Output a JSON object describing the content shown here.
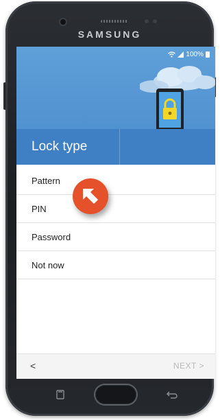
{
  "device": {
    "brand": "SAMSUNG"
  },
  "status_bar": {
    "battery": "100%"
  },
  "screen": {
    "title": "Lock type"
  },
  "lock_options": [
    {
      "label": "Pattern"
    },
    {
      "label": "PIN"
    },
    {
      "label": "Password"
    },
    {
      "label": "Not now"
    }
  ],
  "footer": {
    "back_label": "<",
    "next_label": "NEXT >"
  },
  "colors": {
    "header_blue": "#4a8bcb",
    "title_band_blue": "#3f7fc3",
    "pointer_orange": "#e4512a",
    "next_disabled": "#b9b9b9"
  },
  "icons": {
    "status": [
      "wifi-icon",
      "signal-icon",
      "battery-icon"
    ],
    "illustration": "tablet-lock-icon",
    "pointer": "arrow-pointer-icon",
    "recents": "recents-icon",
    "back": "back-icon"
  }
}
